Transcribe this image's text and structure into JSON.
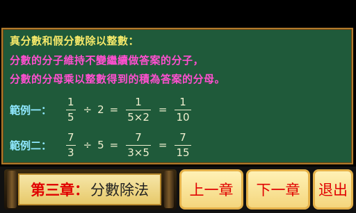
{
  "lesson": {
    "heading": "真分數和假分數除以整數：",
    "rule_line1": "分數的分子維持不變繼續做答案的分子，",
    "rule_line2": "分數的分母乘以整數得到的積為答案的分母。"
  },
  "examples": [
    {
      "label": "範例一：",
      "frac1_num": "1",
      "frac1_den": "5",
      "operator": "÷",
      "divisor": "2",
      "eq": "=",
      "frac2_num": "1",
      "frac2_den": "5×2",
      "frac3_num": "1",
      "frac3_den": "10"
    },
    {
      "label": "範例二：",
      "frac1_num": "7",
      "frac1_den": "3",
      "operator": "÷",
      "divisor": "5",
      "eq": "=",
      "frac2_num": "7",
      "frac2_den": "3×5",
      "frac3_num": "7",
      "frac3_den": "15"
    }
  ],
  "footer": {
    "chapter_highlight": "第三章：",
    "chapter_title": "分數除法",
    "prev_label": "上一章",
    "next_label": "下一章",
    "exit_label": "退出"
  },
  "colors": {
    "board": "#1f5a3a",
    "heading": "#f5e96a",
    "rule_text": "#ff4fd0",
    "example_label": "#8fe8ff",
    "button_text": "#e00000"
  }
}
